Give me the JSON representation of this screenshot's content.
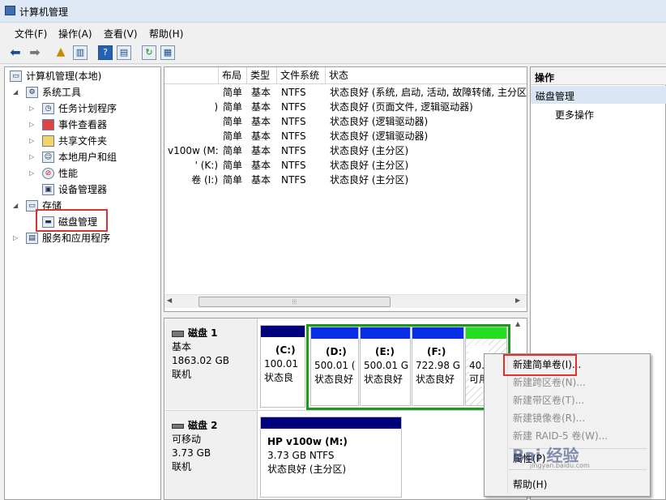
{
  "window": {
    "title": "计算机管理"
  },
  "menu": [
    "文件(F)",
    "操作(A)",
    "查看(V)",
    "帮助(H)"
  ],
  "toolbar_icons": [
    "back-arrow-icon",
    "forward-arrow-icon",
    "up-folder-icon",
    "console-tree-icon",
    "help-icon",
    "properties-icon",
    "refresh-icon",
    "disk-settings-icon"
  ],
  "tree": {
    "root": "计算机管理(本地)",
    "system_tools": "系统工具",
    "items": [
      "任务计划程序",
      "事件查看器",
      "共享文件夹",
      "本地用户和组",
      "性能",
      "设备管理器"
    ],
    "storage": "存储",
    "disk_mgmt": "磁盘管理",
    "services": "服务和应用程序"
  },
  "volume_table": {
    "headers": {
      "layout": "布局",
      "type": "类型",
      "fs": "文件系统",
      "status": "状态"
    },
    "rows": [
      {
        "vol": "",
        "layout": "简单",
        "type": "基本",
        "fs": "NTFS",
        "status": "状态良好 (系统, 启动, 活动, 故障转储, 主分区"
      },
      {
        "vol": ")",
        "layout": "简单",
        "type": "基本",
        "fs": "NTFS",
        "status": "状态良好 (页面文件, 逻辑驱动器)"
      },
      {
        "vol": "",
        "layout": "简单",
        "type": "基本",
        "fs": "NTFS",
        "status": "状态良好 (逻辑驱动器)"
      },
      {
        "vol": "",
        "layout": "简单",
        "type": "基本",
        "fs": "NTFS",
        "status": "状态良好 (逻辑驱动器)"
      },
      {
        "vol": "v100w (M:)",
        "layout": "简单",
        "type": "基本",
        "fs": "NTFS",
        "status": "状态良好 (主分区)"
      },
      {
        "vol": "' (K:)",
        "layout": "简单",
        "type": "基本",
        "fs": "NTFS",
        "status": "状态良好 (主分区)"
      },
      {
        "vol": "卷 (I:)",
        "layout": "简单",
        "type": "基本",
        "fs": "NTFS",
        "status": "状态良好 (主分区)"
      }
    ]
  },
  "disks": [
    {
      "name": "磁盘 1",
      "kind": "基本",
      "size": "1863.02 GB",
      "state": "联机",
      "partitions": [
        {
          "label": "(C:)",
          "size": "100.01",
          "status": "状态良"
        },
        {
          "label": "(D:)",
          "size": "500.01 (",
          "status": "状态良好"
        },
        {
          "label": "(E:)",
          "size": "500.01 G",
          "status": "状态良好"
        },
        {
          "label": "(F:)",
          "size": "722.98 G",
          "status": "状态良好"
        },
        {
          "label": "",
          "size": "40.",
          "status": "可用"
        }
      ]
    },
    {
      "name": "磁盘 2",
      "kind": "可移动",
      "size": "3.73 GB",
      "state": "联机",
      "partitions": [
        {
          "label": "HP v100w  (M:)",
          "size": "3.73 GB NTFS",
          "status": "状态良好 (主分区)"
        }
      ]
    }
  ],
  "actions": {
    "header": "操作",
    "section": "磁盘管理",
    "more": "更多操作"
  },
  "context_menu": [
    {
      "label": "新建简单卷(I)...",
      "enabled": true
    },
    {
      "label": "新建跨区卷(N)...",
      "enabled": false
    },
    {
      "label": "新建带区卷(T)...",
      "enabled": false
    },
    {
      "label": "新建镜像卷(R)...",
      "enabled": false
    },
    {
      "label": "新建 RAID-5 卷(W)...",
      "enabled": false
    },
    {
      "label": "属性(P)",
      "enabled": true
    },
    {
      "label": "帮助(H)",
      "enabled": true
    }
  ],
  "watermark": {
    "text": "Bai 经验",
    "url": "jingyan.baidu.com"
  },
  "colors": {
    "primary_partition": "#00007d",
    "logical_drive": "#0a2ee8",
    "free_space": "#22dd22",
    "extended_border": "#1b9a1b",
    "highlight": "#e3312d"
  }
}
